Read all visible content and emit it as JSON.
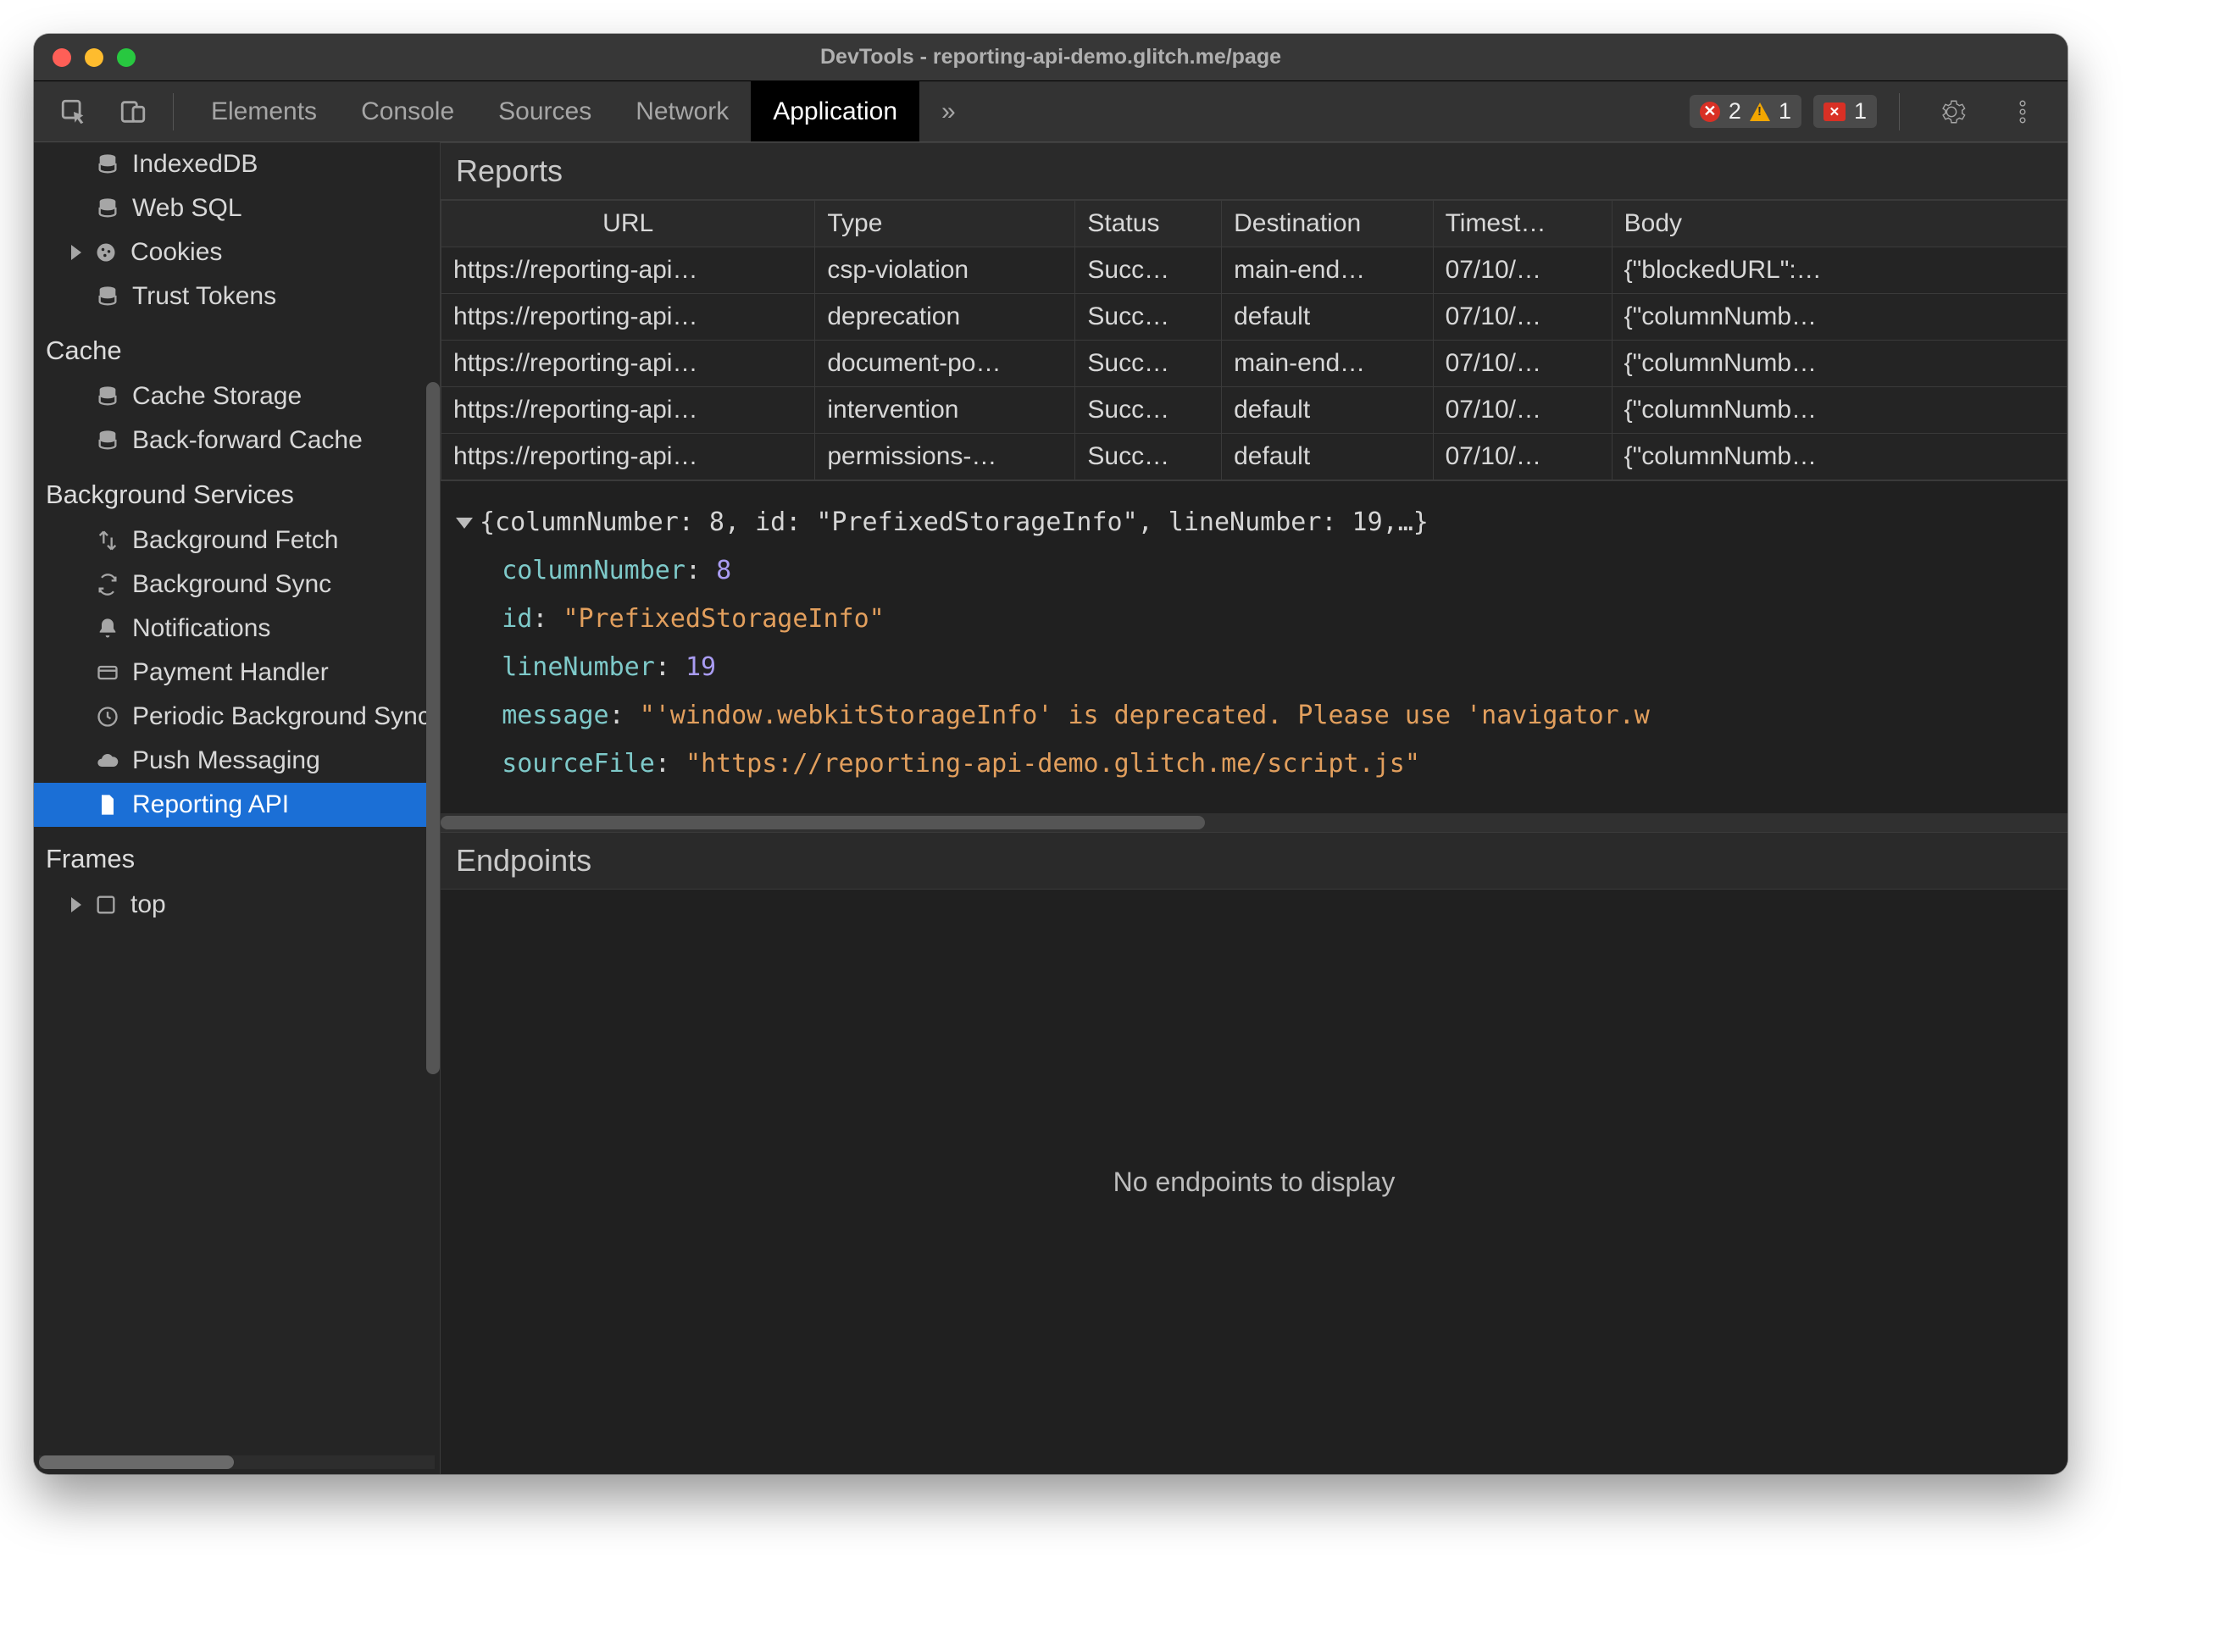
{
  "window": {
    "title": "DevTools - reporting-api-demo.glitch.me/page"
  },
  "toolbar": {
    "tabs": [
      "Elements",
      "Console",
      "Sources",
      "Network",
      "Application"
    ],
    "active_tab_index": 4,
    "more_tabs_glyph": "»",
    "error_count": "2",
    "warning_count": "1",
    "issue_count": "1"
  },
  "sidebar": {
    "storage": {
      "items": [
        {
          "label": "IndexedDB",
          "icon": "database-icon"
        },
        {
          "label": "Web SQL",
          "icon": "database-icon"
        },
        {
          "label": "Cookies",
          "icon": "cookie-icon",
          "expandable": true
        },
        {
          "label": "Trust Tokens",
          "icon": "database-icon"
        }
      ]
    },
    "cache": {
      "title": "Cache",
      "items": [
        {
          "label": "Cache Storage",
          "icon": "database-icon"
        },
        {
          "label": "Back-forward Cache",
          "icon": "database-icon"
        }
      ]
    },
    "background_services": {
      "title": "Background Services",
      "items": [
        {
          "label": "Background Fetch",
          "icon": "transfer-icon"
        },
        {
          "label": "Background Sync",
          "icon": "sync-icon"
        },
        {
          "label": "Notifications",
          "icon": "bell-icon"
        },
        {
          "label": "Payment Handler",
          "icon": "card-icon"
        },
        {
          "label": "Periodic Background Sync",
          "icon": "clock-icon"
        },
        {
          "label": "Push Messaging",
          "icon": "cloud-icon"
        },
        {
          "label": "Reporting API",
          "icon": "file-icon",
          "selected": true
        }
      ]
    },
    "frames": {
      "title": "Frames",
      "items": [
        {
          "label": "top",
          "icon": "frame-icon",
          "expandable": true
        }
      ]
    }
  },
  "reports": {
    "title": "Reports",
    "columns": [
      "URL",
      "Type",
      "Status",
      "Destination",
      "Timest…",
      "Body"
    ],
    "rows": [
      {
        "url": "https://reporting-api…",
        "type": "csp-violation",
        "status": "Succ…",
        "destination": "main-end…",
        "timestamp": "07/10/…",
        "body": "{\"blockedURL\":…"
      },
      {
        "url": "https://reporting-api…",
        "type": "deprecation",
        "status": "Succ…",
        "destination": "default",
        "timestamp": "07/10/…",
        "body": "{\"columnNumb…"
      },
      {
        "url": "https://reporting-api…",
        "type": "document-po…",
        "status": "Succ…",
        "destination": "main-end…",
        "timestamp": "07/10/…",
        "body": "{\"columnNumb…"
      },
      {
        "url": "https://reporting-api…",
        "type": "intervention",
        "status": "Succ…",
        "destination": "default",
        "timestamp": "07/10/…",
        "body": "{\"columnNumb…"
      },
      {
        "url": "https://reporting-api…",
        "type": "permissions-…",
        "status": "Succ…",
        "destination": "default",
        "timestamp": "07/10/…",
        "body": "{\"columnNumb…"
      }
    ]
  },
  "detail": {
    "summary": "{columnNumber: 8, id: \"PrefixedStorageInfo\", lineNumber: 19,…}",
    "columnNumber_key": "columnNumber",
    "columnNumber_val": "8",
    "id_key": "id",
    "id_val": "\"PrefixedStorageInfo\"",
    "lineNumber_key": "lineNumber",
    "lineNumber_val": "19",
    "message_key": "message",
    "message_val": "\"'window.webkitStorageInfo' is deprecated. Please use 'navigator.w",
    "sourceFile_key": "sourceFile",
    "sourceFile_val": "\"https://reporting-api-demo.glitch.me/script.js\""
  },
  "endpoints": {
    "title": "Endpoints",
    "empty_text": "No endpoints to display"
  }
}
